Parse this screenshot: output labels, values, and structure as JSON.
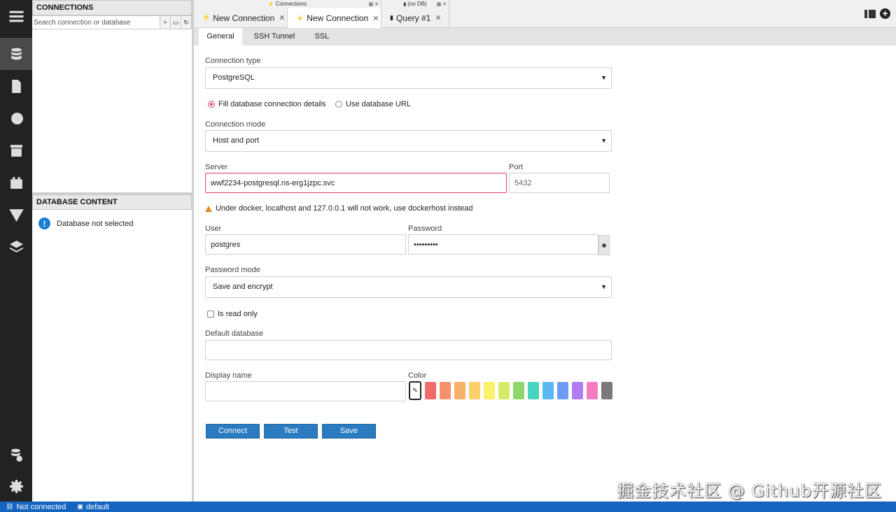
{
  "left_panel": {
    "connections_title": "CONNECTIONS",
    "search_placeholder": "Search connection or database",
    "search_buttons": [
      "+",
      "▭",
      "↻"
    ],
    "database_content_title": "DATABASE CONTENT",
    "database_info": "Database not selected"
  },
  "tabs": {
    "groups": [
      {
        "label": "Connections",
        "icon": "plug-icon"
      },
      {
        "label": "(no DB)",
        "icon": "file-icon"
      }
    ],
    "items": [
      {
        "label": "New Connection",
        "icon": "plug-icon",
        "active": false
      },
      {
        "label": "New Connection",
        "icon": "plug-icon",
        "active": true
      },
      {
        "label": "Query #1",
        "icon": "file-icon",
        "active": false
      }
    ],
    "close_glyph": "✕"
  },
  "subtabs": [
    "General",
    "SSH Tunnel",
    "SSL"
  ],
  "form": {
    "connection_type_label": "Connection type",
    "connection_type_value": "PostgreSQL",
    "radio_fill": "Fill database connection details",
    "radio_url": "Use database URL",
    "connection_mode_label": "Connection mode",
    "connection_mode_value": "Host and port",
    "server_label": "Server",
    "server_value": "wwf2234-postgresql.ns-erg1jzpc.svc",
    "port_label": "Port",
    "port_value": "5432",
    "warning": "Under docker, localhost and 127.0.0.1 will not work, use dockerhost instead",
    "user_label": "User",
    "user_value": "postgres",
    "password_label": "Password",
    "password_value": "•••••••••",
    "password_mode_label": "Password mode",
    "password_mode_value": "Save and encrypt",
    "read_only_label": "Is read only",
    "default_db_label": "Default database",
    "default_db_value": "",
    "display_name_label": "Display name",
    "display_name_value": "",
    "color_label": "Color",
    "color_swatches": [
      "#f26b6b",
      "#f5906a",
      "#f7b06a",
      "#fbcf6a",
      "#fbf06a",
      "#d4ec6a",
      "#8ed66a",
      "#4ad4c0",
      "#5ab8f5",
      "#6e9cf5",
      "#b07cf0",
      "#f57cc0",
      "#7a7a7a"
    ]
  },
  "actions": {
    "connect": "Connect",
    "test": "Test",
    "save": "Save"
  },
  "statusbar": {
    "connection": "Not connected",
    "database": "default"
  },
  "watermark": "掘金技术社区 @ Github开源社区"
}
